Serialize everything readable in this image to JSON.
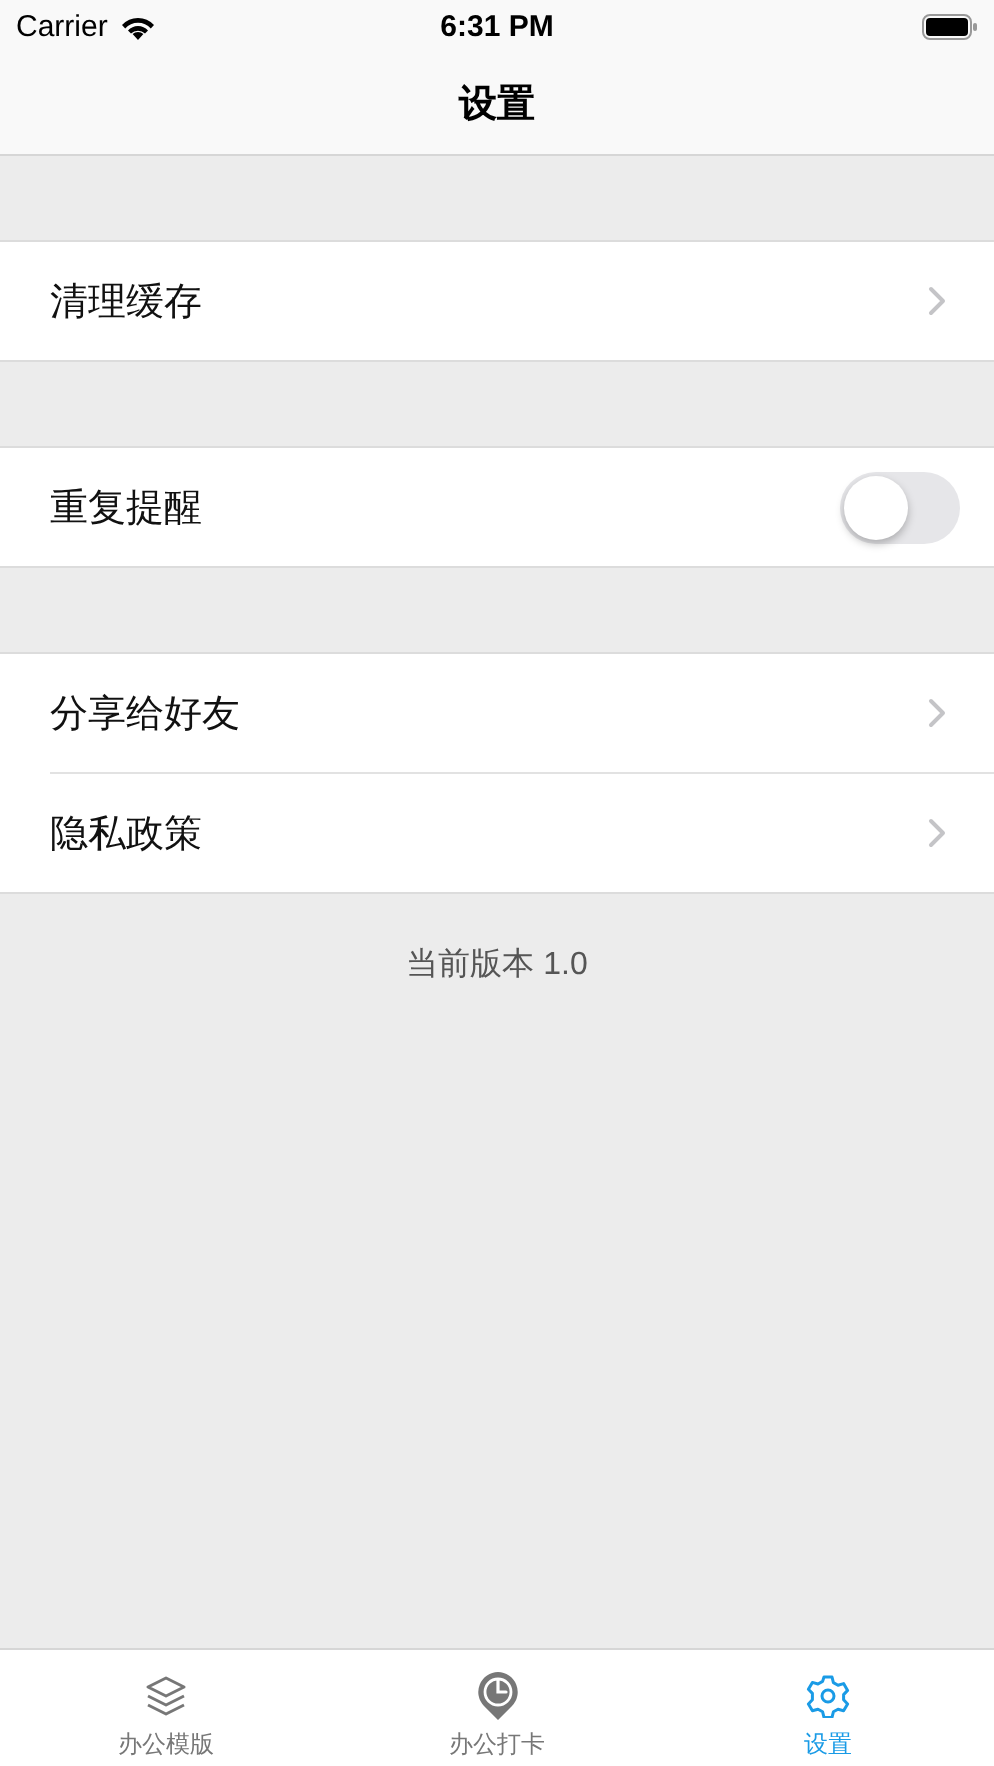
{
  "status_bar": {
    "carrier": "Carrier",
    "time": "6:31 PM"
  },
  "nav_bar": {
    "title": "设置"
  },
  "groups": [
    {
      "rows": [
        {
          "kind": "link",
          "label": "清理缓存"
        }
      ]
    },
    {
      "rows": [
        {
          "kind": "switch",
          "label": "重复提醒",
          "on": false
        }
      ]
    },
    {
      "rows": [
        {
          "kind": "link",
          "label": "分享给好友"
        },
        {
          "kind": "link",
          "label": "隐私政策"
        }
      ]
    }
  ],
  "version": "当前版本 1.0",
  "tab_bar": [
    {
      "label": "办公模版",
      "selected": false
    },
    {
      "label": "办公打卡",
      "selected": false
    },
    {
      "label": "设置",
      "selected": true
    }
  ]
}
